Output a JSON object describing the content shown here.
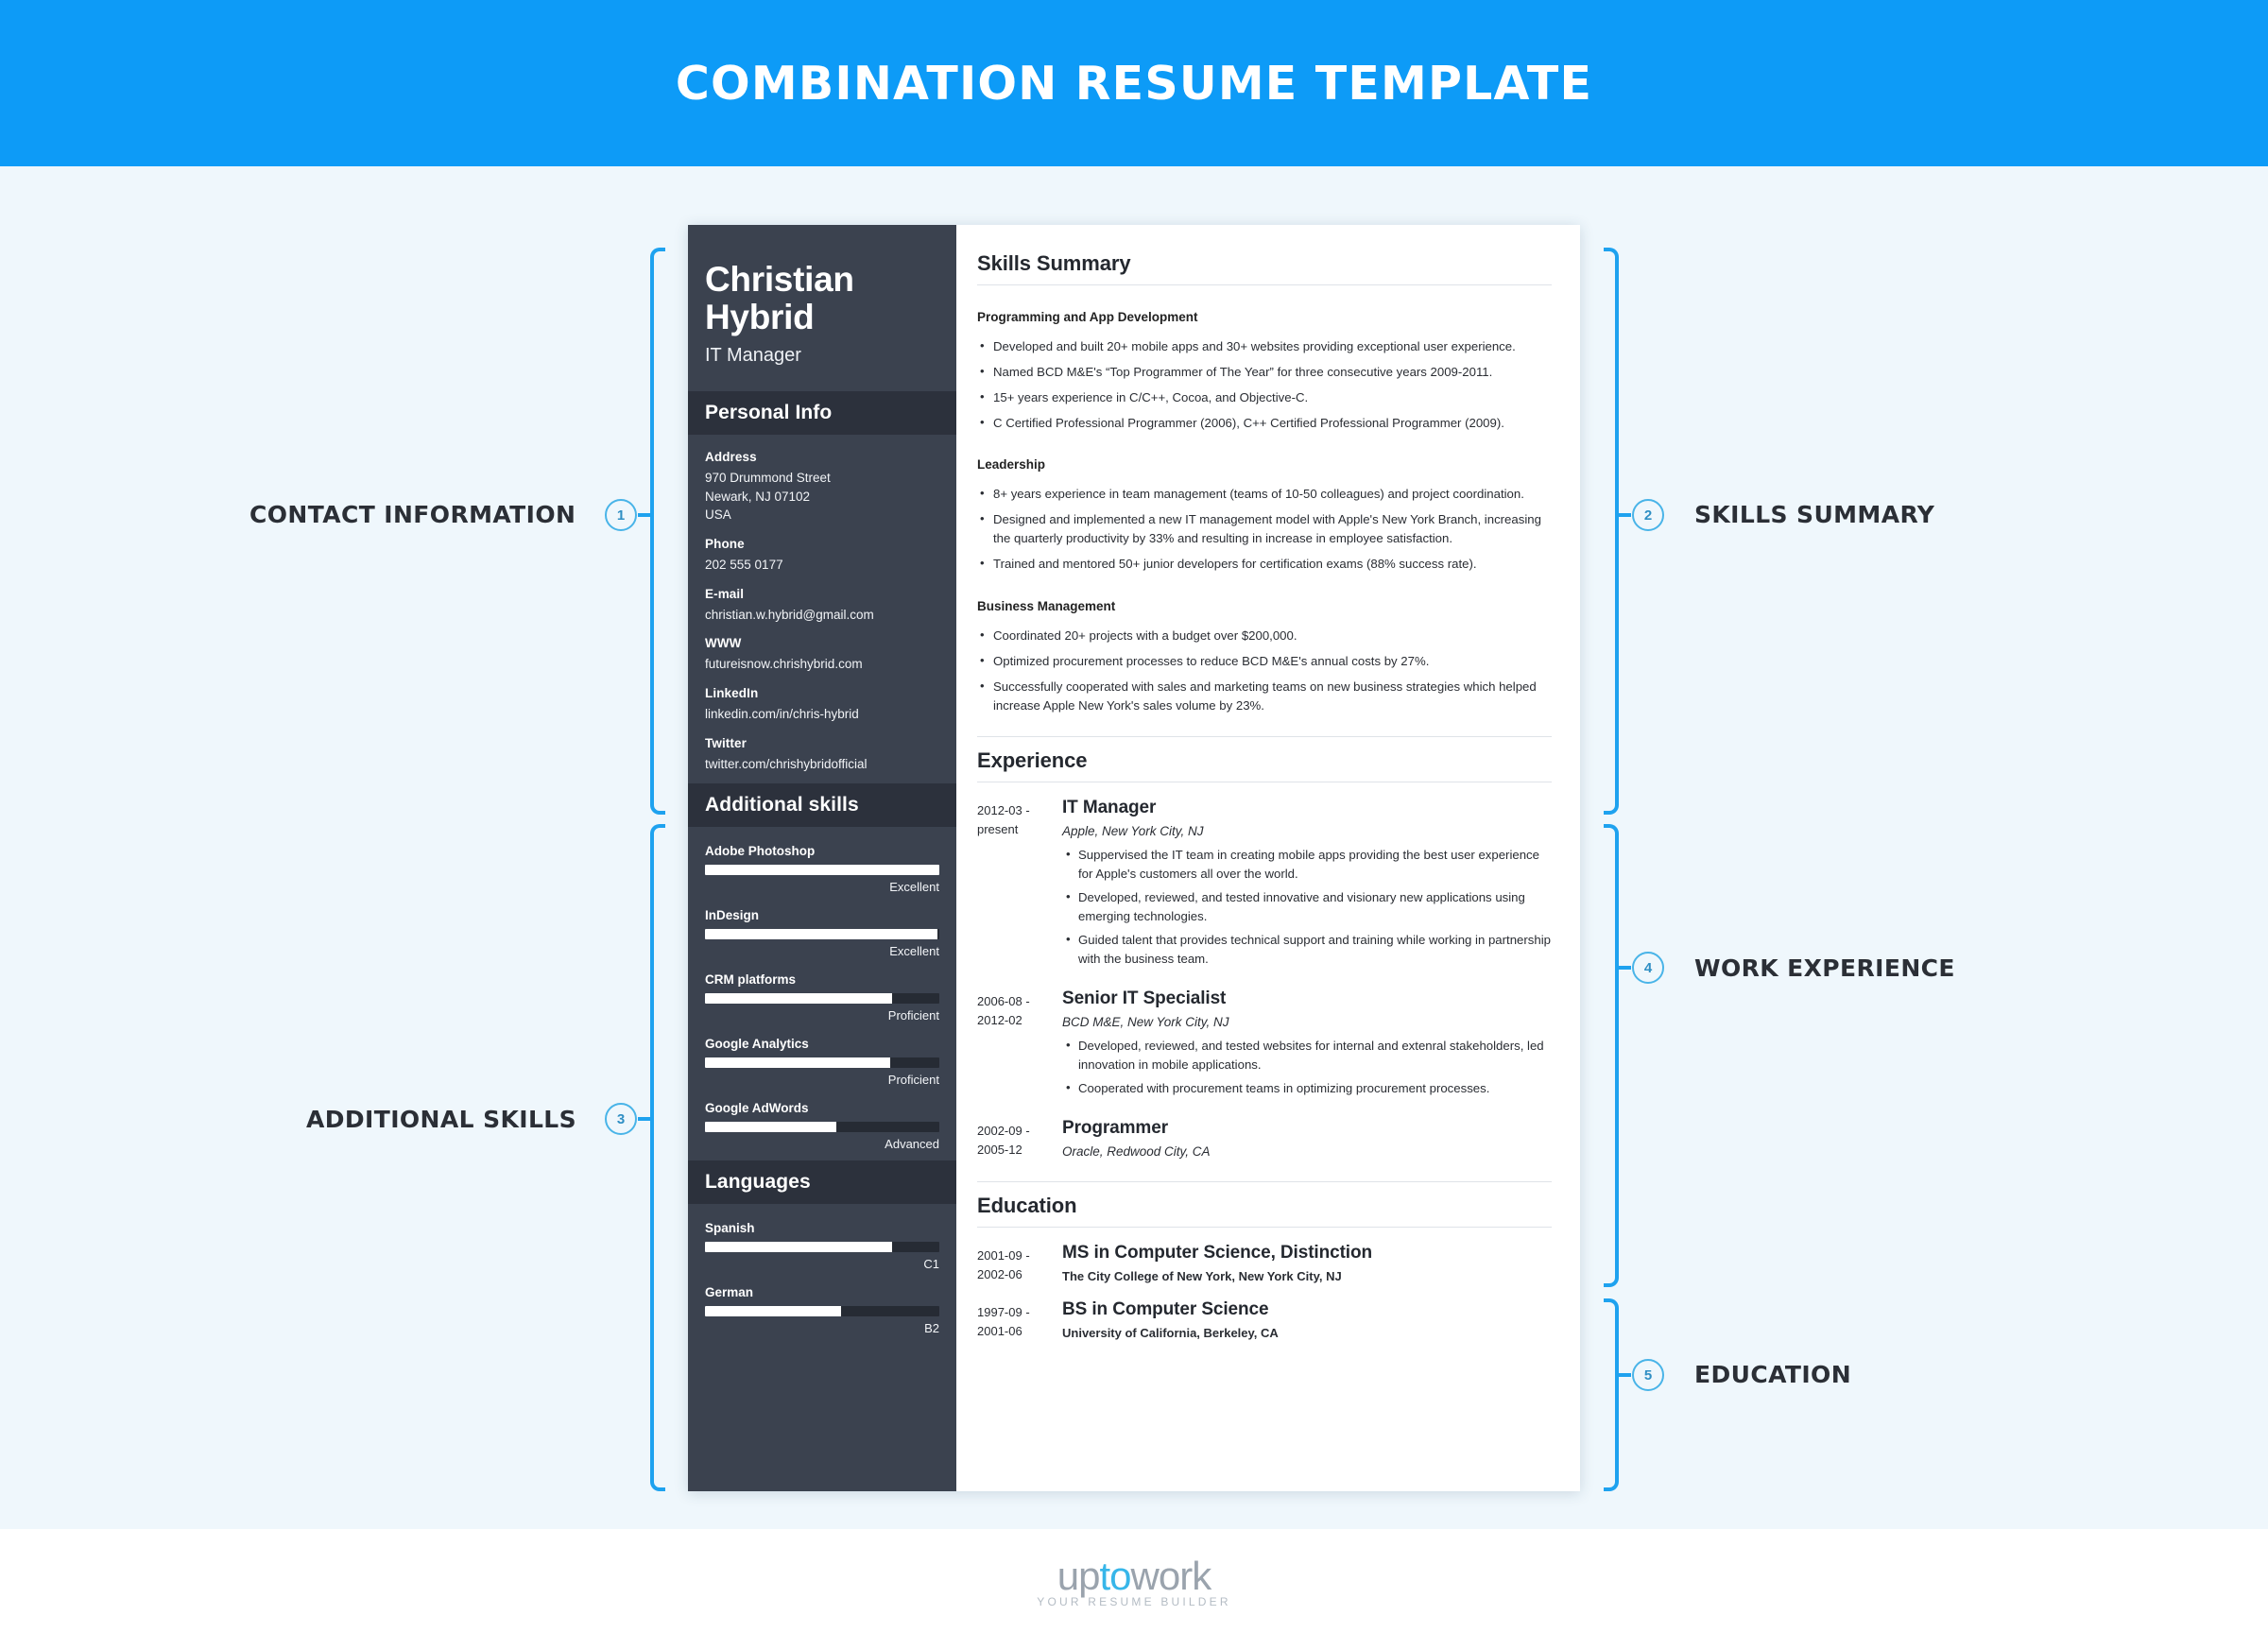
{
  "banner": {
    "title": "COMBINATION RESUME TEMPLATE"
  },
  "resume": {
    "name": "Christian Hybrid",
    "role": "IT Manager",
    "personal_info_heading": "Personal Info",
    "contact": [
      {
        "label": "Address",
        "value": "970 Drummond Street\nNewark, NJ 07102\nUSA"
      },
      {
        "label": "Phone",
        "value": "202 555 0177"
      },
      {
        "label": "E-mail",
        "value": "christian.w.hybrid@gmail.com"
      },
      {
        "label": "WWW",
        "value": "futureisnow.chrishybrid.com"
      },
      {
        "label": "LinkedIn",
        "value": "linkedin.com/in/chris-hybrid"
      },
      {
        "label": "Twitter",
        "value": "twitter.com/chrishybridofficial"
      }
    ],
    "additional_skills_heading": "Additional skills",
    "additional_skills": [
      {
        "name": "Adobe Photoshop",
        "level": "Excellent",
        "percent": 100
      },
      {
        "name": "InDesign",
        "level": "Excellent",
        "percent": 99
      },
      {
        "name": "CRM platforms",
        "level": "Proficient",
        "percent": 80
      },
      {
        "name": "Google Analytics",
        "level": "Proficient",
        "percent": 79
      },
      {
        "name": "Google AdWords",
        "level": "Advanced",
        "percent": 56
      }
    ],
    "languages_heading": "Languages",
    "languages": [
      {
        "name": "Spanish",
        "level": "C1",
        "percent": 80
      },
      {
        "name": "German",
        "level": "B2",
        "percent": 58
      }
    ],
    "skills_summary": {
      "title": "Skills Summary",
      "groups": [
        {
          "heading": "Programming and App Development",
          "bullets": [
            "Developed and built 20+ mobile apps and 30+ websites providing exceptional user experience.",
            "Named BCD M&E's “Top Programmer of The Year” for three consecutive years 2009-2011.",
            "15+ years experience in C/C++, Cocoa, and Objective-C.",
            "C Certified Professional Programmer (2006), C++ Certified Professional Programmer (2009)."
          ]
        },
        {
          "heading": "Leadership",
          "bullets": [
            "8+ years experience in team management (teams of 10-50 colleagues) and project coordination.",
            "Designed and implemented a new IT management model with Apple's New York Branch, increasing the quarterly productivity by 33% and resulting in increase in employee satisfaction.",
            "Trained and mentored 50+ junior developers for certification exams (88% success rate)."
          ]
        },
        {
          "heading": "Business Management",
          "bullets": [
            "Coordinated 20+ projects with a budget over $200,000.",
            "Optimized procurement processes to reduce BCD M&E's annual costs by 27%.",
            "Successfully cooperated with sales and marketing teams on new business strategies which helped increase Apple New York's sales volume by 23%."
          ]
        }
      ]
    },
    "experience": {
      "title": "Experience",
      "entries": [
        {
          "date": "2012-03 - present",
          "title": "IT Manager",
          "org": "Apple, New York City, NJ",
          "bullets": [
            "Suppervised the IT team in creating mobile apps providing the best user experience for Apple's customers all over the world.",
            "Developed, reviewed, and tested innovative and visionary new applications using emerging technologies.",
            "Guided talent that provides technical support and training while working in partnership with the business team."
          ]
        },
        {
          "date": "2006-08 - 2012-02",
          "title": "Senior IT Specialist",
          "org": "BCD M&E, New York City, NJ",
          "bullets": [
            "Developed, reviewed, and tested websites for internal and extenral stakeholders, led innovation in mobile applications.",
            "Cooperated with procurement teams in optimizing procurement processes."
          ]
        },
        {
          "date": "2002-09 - 2005-12",
          "title": "Programmer",
          "org": "Oracle, Redwood City, CA",
          "bullets": []
        }
      ]
    },
    "education": {
      "title": "Education",
      "entries": [
        {
          "date": "2001-09 - 2002-06",
          "title": "MS in Computer Science, Distinction",
          "org": "The City College of New York, New York City, NJ"
        },
        {
          "date": "1997-09 - 2001-06",
          "title": "BS in Computer Science",
          "org": "University of California, Berkeley, CA"
        }
      ]
    }
  },
  "annotations": [
    {
      "number": "1",
      "label": "CONTACT INFORMATION",
      "side": "left"
    },
    {
      "number": "2",
      "label": "SKILLS SUMMARY",
      "side": "right"
    },
    {
      "number": "3",
      "label": "ADDITIONAL SKILLS",
      "side": "left"
    },
    {
      "number": "4",
      "label": "WORK EXPERIENCE",
      "side": "right"
    },
    {
      "number": "5",
      "label": "EDUCATION",
      "side": "right"
    }
  ],
  "footer": {
    "logo_part1": "up",
    "logo_part2": "to",
    "logo_part3": "work",
    "tagline": "YOUR RESUME BUILDER"
  },
  "colors": {
    "banner_blue": "#0d9bf7",
    "accent_blue": "#1ea2ef",
    "sidebar_dark": "#3b424f",
    "sidebar_band": "#2c313c",
    "page_bg": "#eff7fc"
  }
}
